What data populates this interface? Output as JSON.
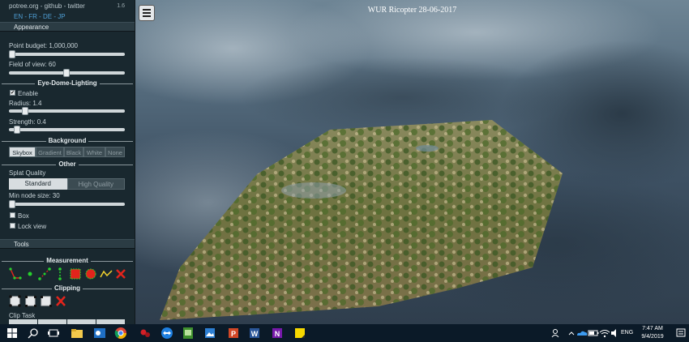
{
  "header": {
    "links": "potree.org - github - twitter",
    "version": "1.6",
    "languages": "EN - FR - DE - JP"
  },
  "appearance": {
    "title": "Appearance",
    "point_budget_label": "Point budget: 1,000,000",
    "point_budget_fraction": 0.0,
    "fov_label": "Field of view: 60",
    "fov_fraction": 0.5
  },
  "edl": {
    "title": "Eye-Dome-Lighting",
    "enable_label": "Enable",
    "enabled": true,
    "radius_label": "Radius: 1.4",
    "radius_fraction": 0.12,
    "strength_label": "Strength: 0.4",
    "strength_fraction": 0.04
  },
  "background": {
    "title": "Background",
    "options": [
      "Skybox",
      "Gradient",
      "Black",
      "White",
      "None"
    ],
    "selected": "Skybox"
  },
  "other": {
    "title": "Other",
    "splat_label": "Splat Quality",
    "splat_options": [
      "Standard",
      "High Quality"
    ],
    "splat_selected": "Standard",
    "min_node_label": "Min node size: 30",
    "min_node_fraction": 0.0,
    "box_label": "Box",
    "lock_label": "Lock view"
  },
  "tools": {
    "title": "Tools",
    "measurement_title": "Measurement",
    "clipping_title": "Clipping",
    "clip_task_label": "Clip Task"
  },
  "viewer": {
    "title": "WUR Ricopter 28-06-2017"
  },
  "taskbar": {
    "language": "ENG",
    "time": "7:47 AM",
    "date": "9/4/2019",
    "icons": [
      "windows-start-icon",
      "search-icon",
      "task-view-icon",
      "file-explorer-icon",
      "outlook-icon",
      "chrome-icon",
      "app-red-icon",
      "teamviewer-icon",
      "app-green-icon",
      "photos-icon",
      "powerpoint-icon",
      "word-icon",
      "onenote-icon",
      "sticky-notes-icon"
    ]
  },
  "colors": {
    "sidebar_bg": "#19282f",
    "header_bg": "#2b3c44",
    "link_blue": "#4f9fd6",
    "tool_red": "#e2241c",
    "tool_green": "#27d02d"
  }
}
